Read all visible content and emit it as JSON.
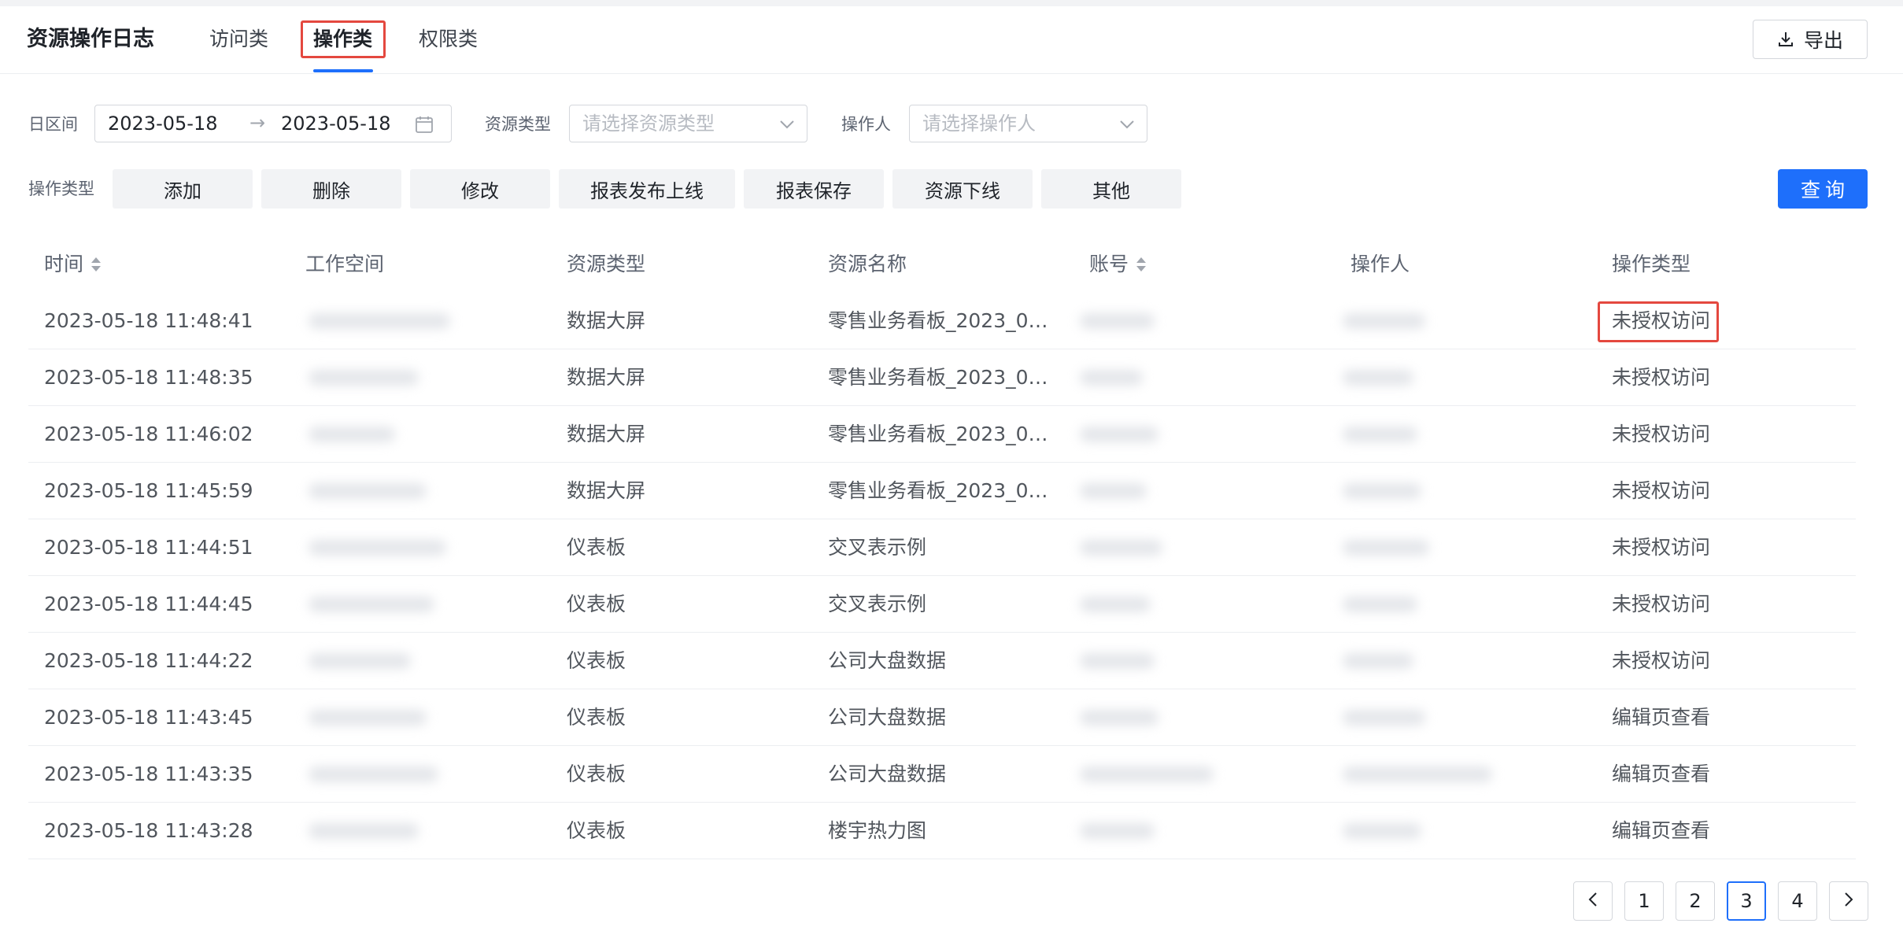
{
  "header": {
    "title": "资源操作日志",
    "tabs": [
      {
        "label": "访问类",
        "active": false
      },
      {
        "label": "操作类",
        "active": true
      },
      {
        "label": "权限类",
        "active": false
      }
    ],
    "export_label": "导出"
  },
  "filters": {
    "date_label": "日区间",
    "date_start": "2023-05-18",
    "date_end": "2023-05-18",
    "date_separator": "→",
    "resource_type_label": "资源类型",
    "resource_type_placeholder": "请选择资源类型",
    "operator_label": "操作人",
    "operator_placeholder": "请选择操作人",
    "op_type_label": "操作类型",
    "op_types": [
      "添加",
      "删除",
      "修改",
      "报表发布上线",
      "报表保存",
      "资源下线",
      "其他"
    ],
    "query_label": "查询"
  },
  "table": {
    "columns": [
      "时间",
      "工作空间",
      "资源类型",
      "资源名称",
      "账号",
      "操作人",
      "操作类型"
    ],
    "rows": [
      {
        "time": "2023-05-18 11:48:41",
        "resource_type": "数据大屏",
        "resource_name": "零售业务看板_2023_03...",
        "op_type": "未授权访问"
      },
      {
        "time": "2023-05-18 11:48:35",
        "resource_type": "数据大屏",
        "resource_name": "零售业务看板_2023_03...",
        "op_type": "未授权访问"
      },
      {
        "time": "2023-05-18 11:46:02",
        "resource_type": "数据大屏",
        "resource_name": "零售业务看板_2023_03...",
        "op_type": "未授权访问"
      },
      {
        "time": "2023-05-18 11:45:59",
        "resource_type": "数据大屏",
        "resource_name": "零售业务看板_2023_03...",
        "op_type": "未授权访问"
      },
      {
        "time": "2023-05-18 11:44:51",
        "resource_type": "仪表板",
        "resource_name": "交叉表示例",
        "op_type": "未授权访问"
      },
      {
        "time": "2023-05-18 11:44:45",
        "resource_type": "仪表板",
        "resource_name": "交叉表示例",
        "op_type": "未授权访问"
      },
      {
        "time": "2023-05-18 11:44:22",
        "resource_type": "仪表板",
        "resource_name": "公司大盘数据",
        "op_type": "未授权访问"
      },
      {
        "time": "2023-05-18 11:43:45",
        "resource_type": "仪表板",
        "resource_name": "公司大盘数据",
        "op_type": "编辑页查看"
      },
      {
        "time": "2023-05-18 11:43:35",
        "resource_type": "仪表板",
        "resource_name": "公司大盘数据",
        "op_type": "编辑页查看"
      },
      {
        "time": "2023-05-18 11:43:28",
        "resource_type": "仪表板",
        "resource_name": "楼宇热力图",
        "op_type": "编辑页查看"
      }
    ]
  },
  "pagination": {
    "pages": [
      "1",
      "2",
      "3",
      "4"
    ],
    "current": "3"
  },
  "colors": {
    "accent": "#1e6ffb",
    "highlight_box": "#e4483f"
  },
  "icons": {
    "export": "download-icon",
    "calendar": "calendar-icon",
    "dropdown": "chevron-down-icon",
    "sort": "sort-icon",
    "prev": "chevron-left-icon",
    "next": "chevron-right-icon"
  }
}
